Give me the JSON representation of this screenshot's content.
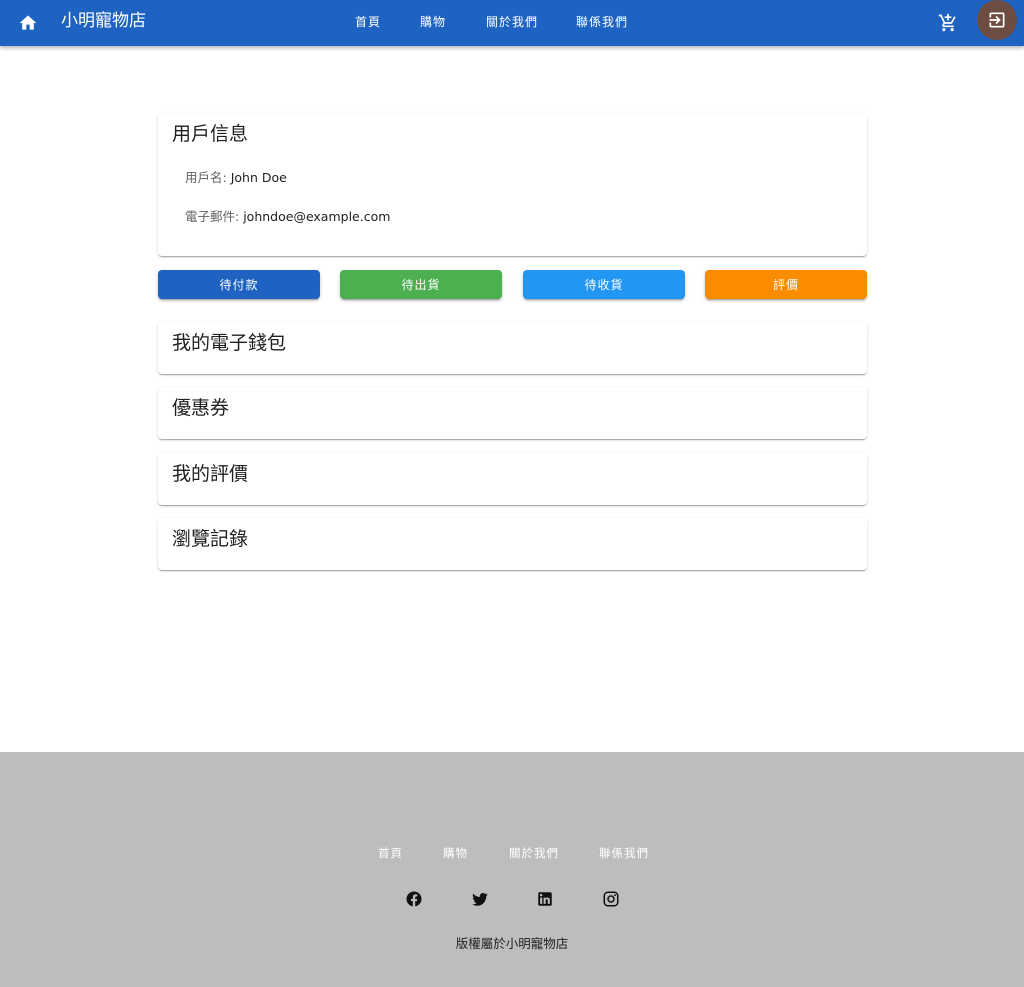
{
  "header": {
    "brand": "小明寵物店",
    "nav": [
      "首頁",
      "購物",
      "關於我們",
      "聯係我們"
    ]
  },
  "user_info": {
    "title": "用戶信息",
    "username_label": "用戶名:",
    "username": "John Doe",
    "email_label": "電子郵件:",
    "email": "johndoe@example.com"
  },
  "order_status": [
    {
      "label": "待付款",
      "color": "#1e63c1"
    },
    {
      "label": "待出貨",
      "color": "#4caf50"
    },
    {
      "label": "待收貨",
      "color": "#2196f3"
    },
    {
      "label": "評價",
      "color": "#fb8c00"
    }
  ],
  "sections": [
    "我的電子錢包",
    "優惠券",
    "我的評價",
    "瀏覽記錄"
  ],
  "footer": {
    "links": [
      "首頁",
      "購物",
      "關於我們",
      "聯係我們"
    ],
    "social": [
      "facebook-icon",
      "twitter-icon",
      "linkedin-icon",
      "instagram-icon"
    ],
    "copyright": "版權屬於小明寵物店"
  },
  "colors": {
    "primary": "#1e63c1",
    "footer_bg": "#bdbdbd",
    "avatar": "#6d4c41"
  }
}
